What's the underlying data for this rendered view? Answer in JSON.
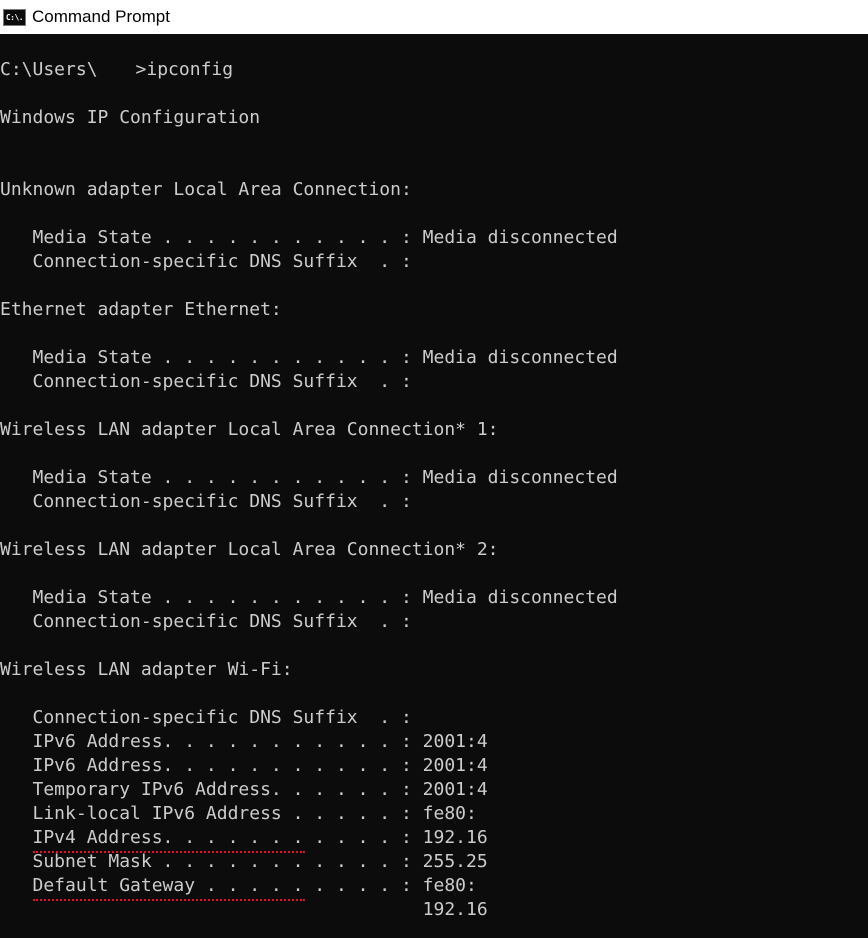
{
  "window": {
    "title": "Command Prompt",
    "icon": "command-prompt-icon",
    "icon_text": "C:\\."
  },
  "console": {
    "prompt_prefix": "C:\\Users\\",
    "prompt_suffix": ">ipconfig",
    "heading": "Windows IP Configuration",
    "adapters": [
      {
        "header": "Unknown adapter Local Area Connection:",
        "media_state": "   Media State . . . . . . . . . . . : Media disconnected",
        "dns_suffix": "   Connection-specific DNS Suffix  . :"
      },
      {
        "header": "Ethernet adapter Ethernet:",
        "media_state": "   Media State . . . . . . . . . . . : Media disconnected",
        "dns_suffix": "   Connection-specific DNS Suffix  . :"
      },
      {
        "header": "Wireless LAN adapter Local Area Connection* 1:",
        "media_state": "   Media State . . . . . . . . . . . : Media disconnected",
        "dns_suffix": "   Connection-specific DNS Suffix  . :"
      },
      {
        "header": "Wireless LAN adapter Local Area Connection* 2:",
        "media_state": "   Media State . . . . . . . . . . . : Media disconnected",
        "dns_suffix": "   Connection-specific DNS Suffix  . :"
      }
    ],
    "wifi": {
      "header": "Wireless LAN adapter Wi-Fi:",
      "dns_suffix": "   Connection-specific DNS Suffix  . :",
      "ipv6_1": "   IPv6 Address. . . . . . . . . . . : 2001:4",
      "ipv6_2": "   IPv6 Address. . . . . . . . . . . : 2001:4",
      "temp_ipv6": "   Temporary IPv6 Address. . . . . . : 2001:4",
      "link_local": "   Link-local IPv6 Address . . . . . : fe80:",
      "ipv4": "   IPv4 Address. . . . . . . . . . . : 192.16",
      "subnet": "   Subnet Mask . . . . . . . . . . . : 255.25",
      "gateway": "   Default Gateway . . . . . . . . . : fe80:",
      "gateway_2": "                                       192.16"
    }
  },
  "colors": {
    "console_bg": "#0c0c0c",
    "console_text": "#cccccc",
    "highlight_underline": "#e81123"
  }
}
